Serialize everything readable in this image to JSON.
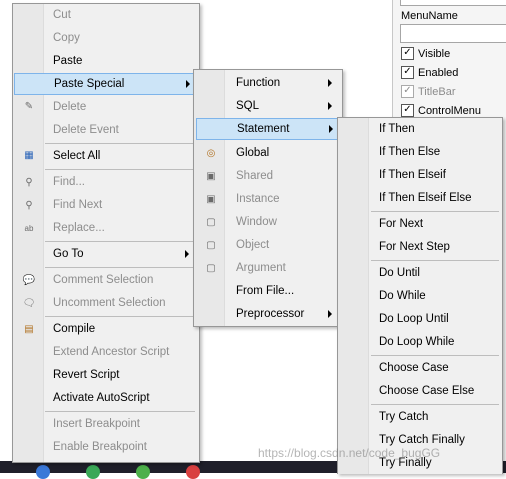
{
  "props": {
    "menuname_label": "MenuName",
    "checks": [
      {
        "label": "Visible",
        "checked": true,
        "disabled": false
      },
      {
        "label": "Enabled",
        "checked": true,
        "disabled": false
      },
      {
        "label": "TitleBar",
        "checked": true,
        "disabled": true
      },
      {
        "label": "ControlMenu",
        "checked": true,
        "disabled": false
      }
    ]
  },
  "menu1": {
    "items": [
      "Cut",
      "Copy",
      "Paste",
      "Paste Special",
      "Delete",
      "Delete Event",
      "Select All",
      "Find...",
      "Find Next",
      "Replace...",
      "Go To",
      "Comment Selection",
      "Uncomment Selection",
      "Compile",
      "Extend Ancestor Script",
      "Revert Script",
      "Activate AutoScript",
      "Insert Breakpoint",
      "Enable Breakpoint"
    ]
  },
  "menu2": {
    "items": [
      "Function",
      "SQL",
      "Statement",
      "Global",
      "Shared",
      "Instance",
      "Window",
      "Object",
      "Argument",
      "From File...",
      "Preprocessor"
    ]
  },
  "menu3": {
    "items": [
      "If Then",
      "If Then Else",
      "If Then Elseif",
      "If Then Elseif Else",
      "For Next",
      "For Next Step",
      "Do Until",
      "Do While",
      "Do Loop Until",
      "Do Loop While",
      "Choose Case",
      "Choose Case Else",
      "Try Catch",
      "Try Catch Finally",
      "Try Finally"
    ]
  },
  "watermark": "https://blog.csdn.net/code_bugGG",
  "colors": {
    "highlight": "#cce4f7",
    "highlight_border": "#7eb4ea",
    "menu_bg": "#f0f0f0"
  }
}
